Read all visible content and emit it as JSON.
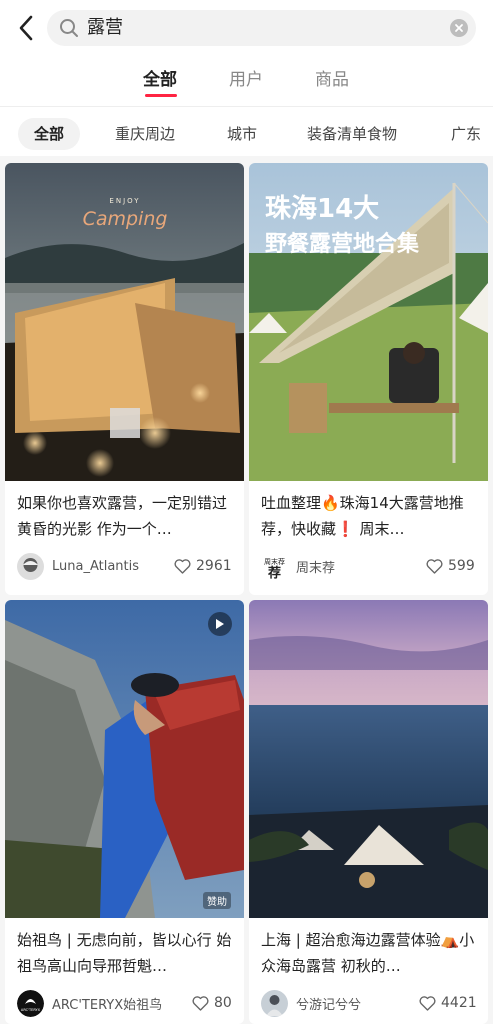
{
  "search": {
    "query": "露营"
  },
  "tabs": [
    {
      "label": "全部",
      "active": true
    },
    {
      "label": "用户",
      "active": false
    },
    {
      "label": "商品",
      "active": false
    }
  ],
  "filters": [
    {
      "label": "全部",
      "active": true
    },
    {
      "label": "重庆周边",
      "active": false
    },
    {
      "label": "城市",
      "active": false
    },
    {
      "label": "装备清单食物",
      "active": false
    },
    {
      "label": "广东",
      "active": false
    }
  ],
  "posts": [
    {
      "cover_text": [
        "ENJOY",
        "Camping"
      ],
      "title": "如果你也喜欢露营，一定别错过黄昏的光影 作为一个…",
      "author": "Luna_Atlantis",
      "likes": "2961"
    },
    {
      "cover_text": [
        "珠海14大",
        "野餐露营地合集"
      ],
      "title": "吐血整理🔥珠海14大露营地推荐，快收藏❗ 周末…",
      "author": "周末荐",
      "avatar_text": "周末\n荐",
      "likes": "599"
    },
    {
      "is_video": true,
      "badge": "赞助",
      "title": "始祖鸟 | 无虑向前，皆以心行 始祖鸟高山向导邢哲魁…",
      "author": "ARC'TERYX始祖鸟",
      "avatar_text": "ARC'TERYX",
      "likes": "80"
    },
    {
      "title": "上海 | 超治愈海边露营体验⛺小众海岛露营 初秋的…",
      "author": "兮游记兮兮",
      "likes": "4421"
    }
  ],
  "colors": {
    "accent": "#ff2442",
    "page_bg": "#f5f5f5",
    "card_bg": "#ffffff"
  }
}
